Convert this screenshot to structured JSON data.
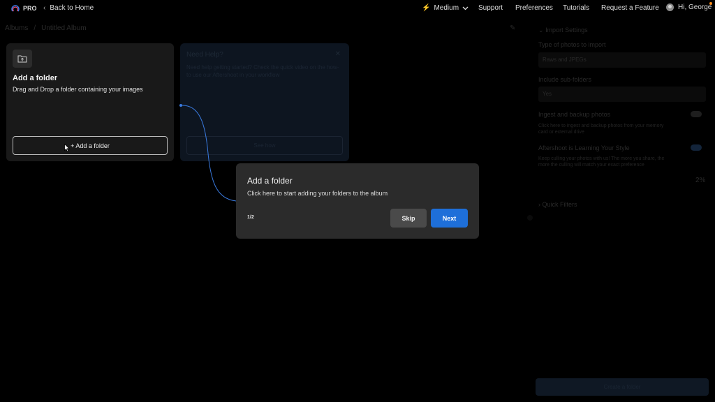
{
  "topbar": {
    "brand": "PRO",
    "back_label": "Back to Home",
    "speed_label": "Medium",
    "nav": [
      "Support",
      "Preferences",
      "Tutorials",
      "Request a Feature"
    ],
    "greeting": "Hi, George"
  },
  "breadcrumb": {
    "root": "Albums",
    "separator": "/",
    "current": "Untitled Album"
  },
  "add_folder_card": {
    "title": "Add a folder",
    "subtitle": "Drag and Drop a folder containing your images",
    "button_label": "+ Add a folder"
  },
  "help_card": {
    "title": "Need Help?",
    "description": "Need help getting started? Check the quick video on the how-to use our Aftershoot in your workflow",
    "button_label": "See how"
  },
  "settings": {
    "section_title": "Import Settings",
    "photo_type_label": "Type of photos to import",
    "photo_type_value": "Raws and JPEGs",
    "subfolders_label": "Include sub-folders",
    "subfolders_value": "Yes",
    "ingest_label": "Ingest and backup photos",
    "ingest_desc": "Click here to ingest and backup photos from your memory card or external drive",
    "learning_label": "Aftershoot is Learning Your Style",
    "learning_desc": "Keep culling your photos with us! The more you share, the more the culling will match your exact preference",
    "learning_percent": "2%",
    "quick_filters_label": "Quick Filters",
    "bottom_button": "Create a folder"
  },
  "tour": {
    "title": "Add a folder",
    "description": "Click here to start adding your folders to the album",
    "step": "1/2",
    "skip_label": "Skip",
    "next_label": "Next"
  },
  "colors": {
    "accent": "#1e6fd9",
    "bolt": "#f5b21b",
    "notification": "#ff8c1a",
    "dialog_bg": "#2b2b2b"
  }
}
